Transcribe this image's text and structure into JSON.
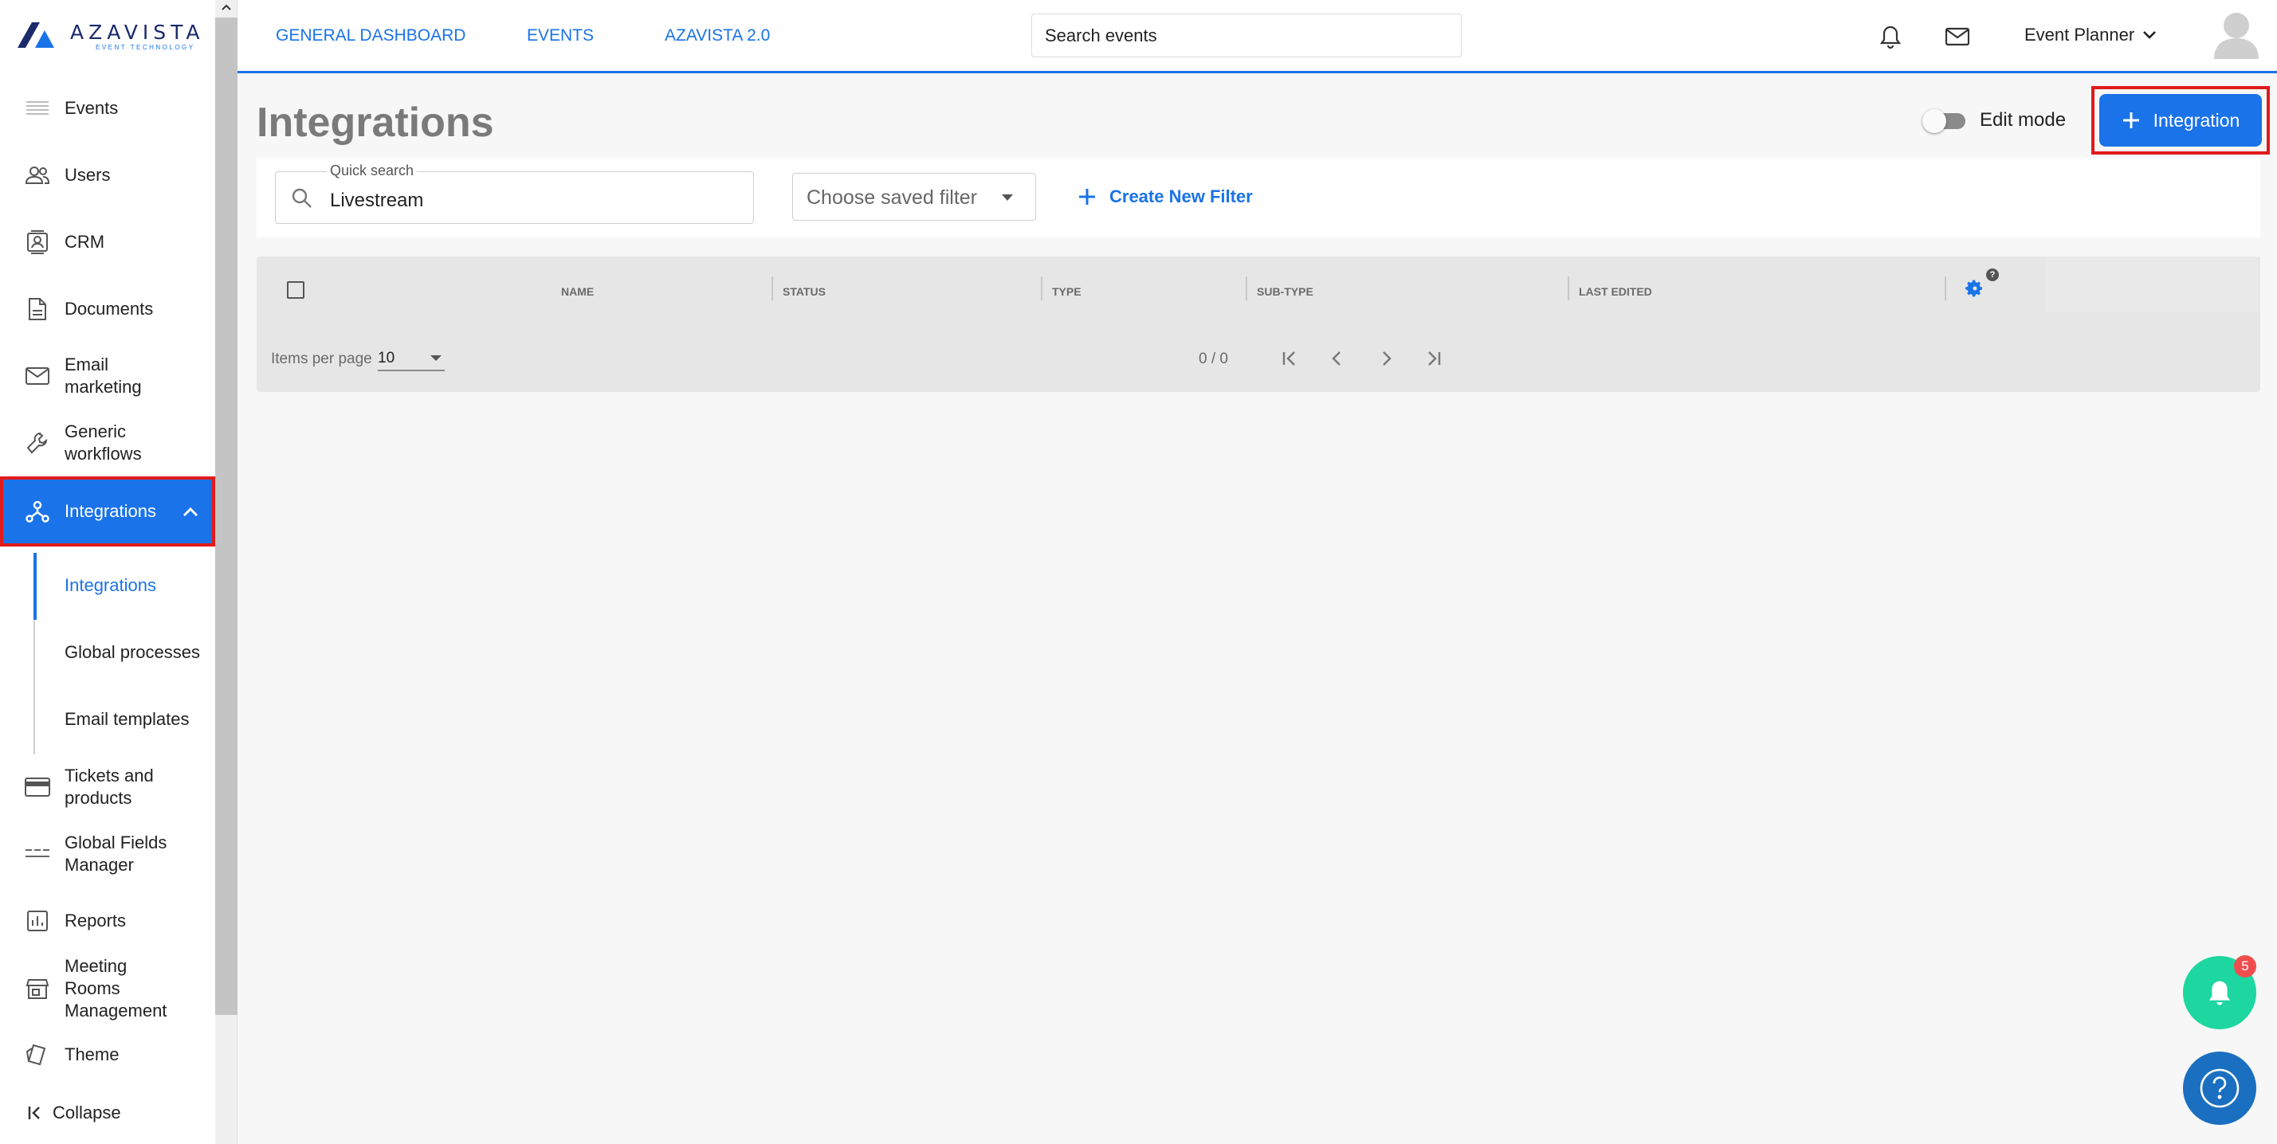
{
  "brand": {
    "name": "AZAVISTA",
    "tagline": "EVENT TECHNOLOGY"
  },
  "colors": {
    "accent": "#1a73e8",
    "highlight_border": "#e01b1b",
    "fab_notifications": "#1ed6a0",
    "fab_help": "#1a6fc0"
  },
  "sidebar": {
    "items": [
      {
        "label": "Events",
        "icon": "list-icon"
      },
      {
        "label": "Users",
        "icon": "users-icon"
      },
      {
        "label": "CRM",
        "icon": "contact-card-icon"
      },
      {
        "label": "Documents",
        "icon": "document-icon"
      },
      {
        "label": "Email marketing",
        "icon": "mail-icon"
      },
      {
        "label": "Generic workflows",
        "icon": "wrench-icon"
      },
      {
        "label": "Integrations",
        "icon": "hub-icon",
        "active": true,
        "expanded": true
      },
      {
        "label": "Tickets and products",
        "icon": "credit-card-icon"
      },
      {
        "label": "Global Fields Manager",
        "icon": "fields-icon"
      },
      {
        "label": "Reports",
        "icon": "bar-chart-icon"
      },
      {
        "label": "Meeting Rooms Management",
        "icon": "store-icon"
      },
      {
        "label": "Theme",
        "icon": "paint-icon"
      }
    ],
    "subitems": [
      {
        "label": "Integrations",
        "selected": true
      },
      {
        "label": "Global processes"
      },
      {
        "label": "Email templates"
      }
    ],
    "collapse_label": "Collapse"
  },
  "topbar": {
    "links": [
      "GENERAL DASHBOARD",
      "EVENTS",
      "AZAVISTA 2.0"
    ],
    "search_placeholder": "Search events",
    "user_menu": "Event Planner"
  },
  "page": {
    "title": "Integrations",
    "edit_mode_label": "Edit mode",
    "edit_mode_on": false,
    "add_button": "Integration"
  },
  "filters": {
    "quick_search_label": "Quick search",
    "quick_search_value": "Livestream",
    "saved_filter_placeholder": "Choose saved filter",
    "create_filter": "Create New Filter"
  },
  "table": {
    "columns": [
      "NAME",
      "STATUS",
      "TYPE",
      "SUB-TYPE",
      "LAST EDITED"
    ],
    "rows": [],
    "items_per_page_label": "Items per page",
    "items_per_page": "10",
    "range": "0 / 0",
    "settings_help": "?"
  },
  "notifications": {
    "count": "5"
  }
}
